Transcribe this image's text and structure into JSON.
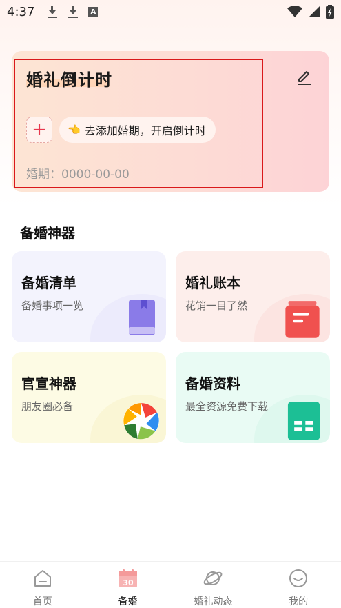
{
  "status_bar": {
    "time": "4:37",
    "icons": [
      "download-icon",
      "download-icon",
      "a-badge-icon",
      "wifi-icon",
      "signal-icon",
      "battery-icon"
    ]
  },
  "countdown": {
    "title": "婚礼倒计时",
    "add_hint": "去添加婚期，开启倒计时",
    "hand_glyph": "👈",
    "add_glyph": "+",
    "date_label": "婚期：0000-00-00",
    "highlight_color": "#d9191b"
  },
  "section": {
    "title": "备婚神器"
  },
  "tools": [
    {
      "title": "备婚清单",
      "subtitle": "备婚事项一览",
      "icon": "book-icon"
    },
    {
      "title": "婚礼账本",
      "subtitle": "花销一目了然",
      "icon": "ledger-icon"
    },
    {
      "title": "官宣神器",
      "subtitle": "朋友圈必备",
      "icon": "camera-aperture-icon"
    },
    {
      "title": "备婚资料",
      "subtitle": "最全资源免费下载",
      "icon": "spreadsheet-icon"
    }
  ],
  "nav": {
    "items": [
      {
        "label": "首页",
        "icon": "home-icon",
        "active": false
      },
      {
        "label": "备婚",
        "icon": "calendar-icon",
        "badge": "30",
        "active": true
      },
      {
        "label": "婚礼动态",
        "icon": "planet-icon",
        "active": false
      },
      {
        "label": "我的",
        "icon": "smile-icon",
        "active": false
      }
    ]
  }
}
